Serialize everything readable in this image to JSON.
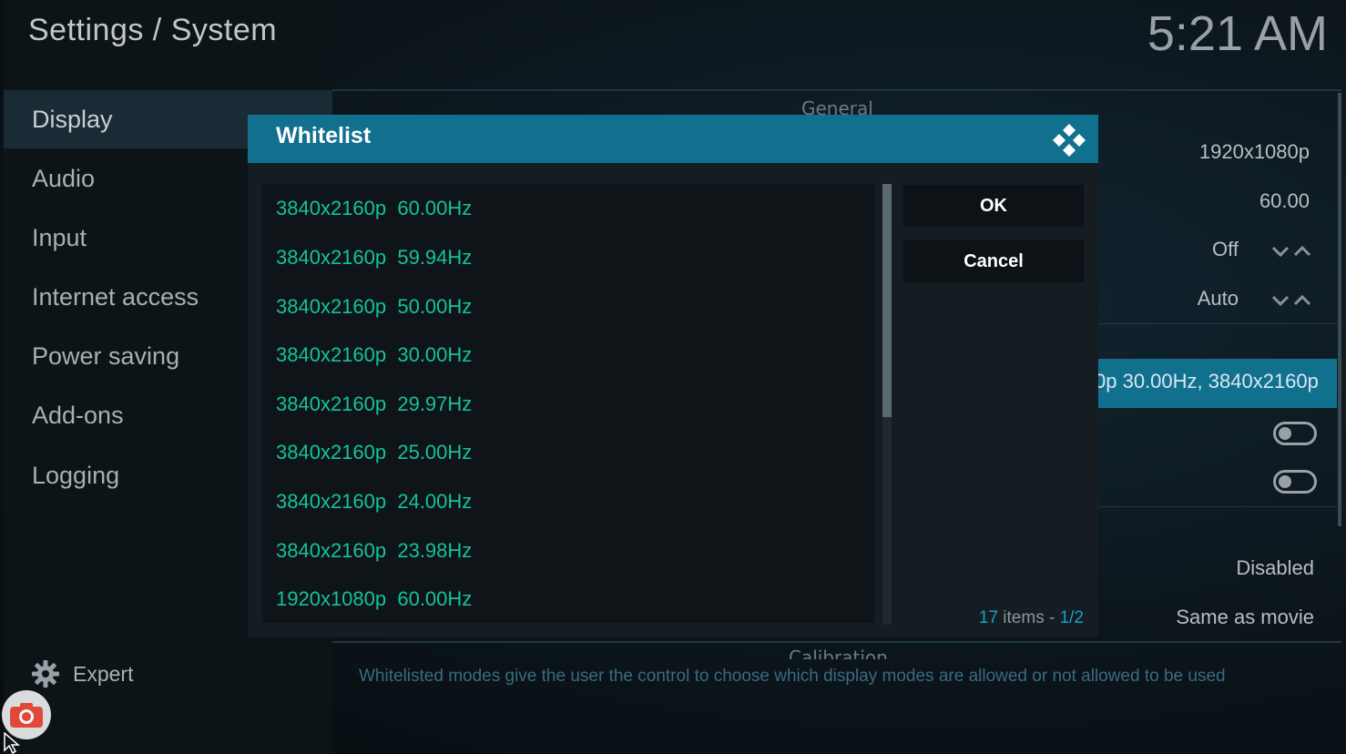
{
  "header": {
    "title": "Settings / System",
    "clock": "5:21 AM"
  },
  "sidebar": {
    "items": [
      {
        "label": "Display"
      },
      {
        "label": "Audio"
      },
      {
        "label": "Input"
      },
      {
        "label": "Internet access"
      },
      {
        "label": "Power saving"
      },
      {
        "label": "Add-ons"
      },
      {
        "label": "Logging"
      }
    ],
    "level_label": "Expert"
  },
  "background_panel": {
    "section_general": "General",
    "resolution_value": "1920x1080p",
    "refresh_value": "60.00",
    "setting_off": "Off",
    "setting_auto": "Auto",
    "whitelist_value": "0p  30.00Hz, 3840x2160p",
    "disabled_value": "Disabled",
    "same_as_movie_value": "Same as movie",
    "section_calibration": "Calibration",
    "hint": "Whitelisted modes give the user the control to choose which display modes are allowed or not allowed to be used"
  },
  "dialog": {
    "title": "Whitelist",
    "items": [
      "3840x2160p  60.00Hz",
      "3840x2160p  59.94Hz",
      "3840x2160p  50.00Hz",
      "3840x2160p  30.00Hz",
      "3840x2160p  29.97Hz",
      "3840x2160p  25.00Hz",
      "3840x2160p  24.00Hz",
      "3840x2160p  23.98Hz",
      "1920x1080p  60.00Hz"
    ],
    "ok_label": "OK",
    "cancel_label": "Cancel",
    "count_number": "17",
    "count_word": " items - ",
    "page": "1/2"
  },
  "colors": {
    "accent": "#12708f",
    "list_text": "#13c39a",
    "page_indicator": "#12a2c7"
  }
}
